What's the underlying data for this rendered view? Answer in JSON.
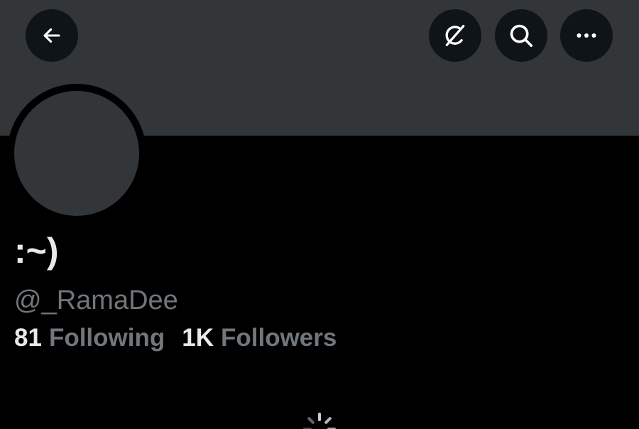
{
  "header": {
    "back_icon": "arrow-left-icon",
    "grok_icon": "grok-icon",
    "search_icon": "search-icon",
    "more_icon": "more-horizontal-icon"
  },
  "profile": {
    "display_name": ":~)",
    "handle": "@_RamaDee",
    "following_count": "81",
    "following_label": "Following",
    "followers_count": "1K",
    "followers_label": "Followers"
  },
  "loading": {
    "icon": "loading-spinner-icon"
  },
  "colors": {
    "background": "#000000",
    "banner": "#333639",
    "button_bg": "#0f1419",
    "primary_text": "#e7e9ea",
    "secondary_text": "#71767b"
  }
}
